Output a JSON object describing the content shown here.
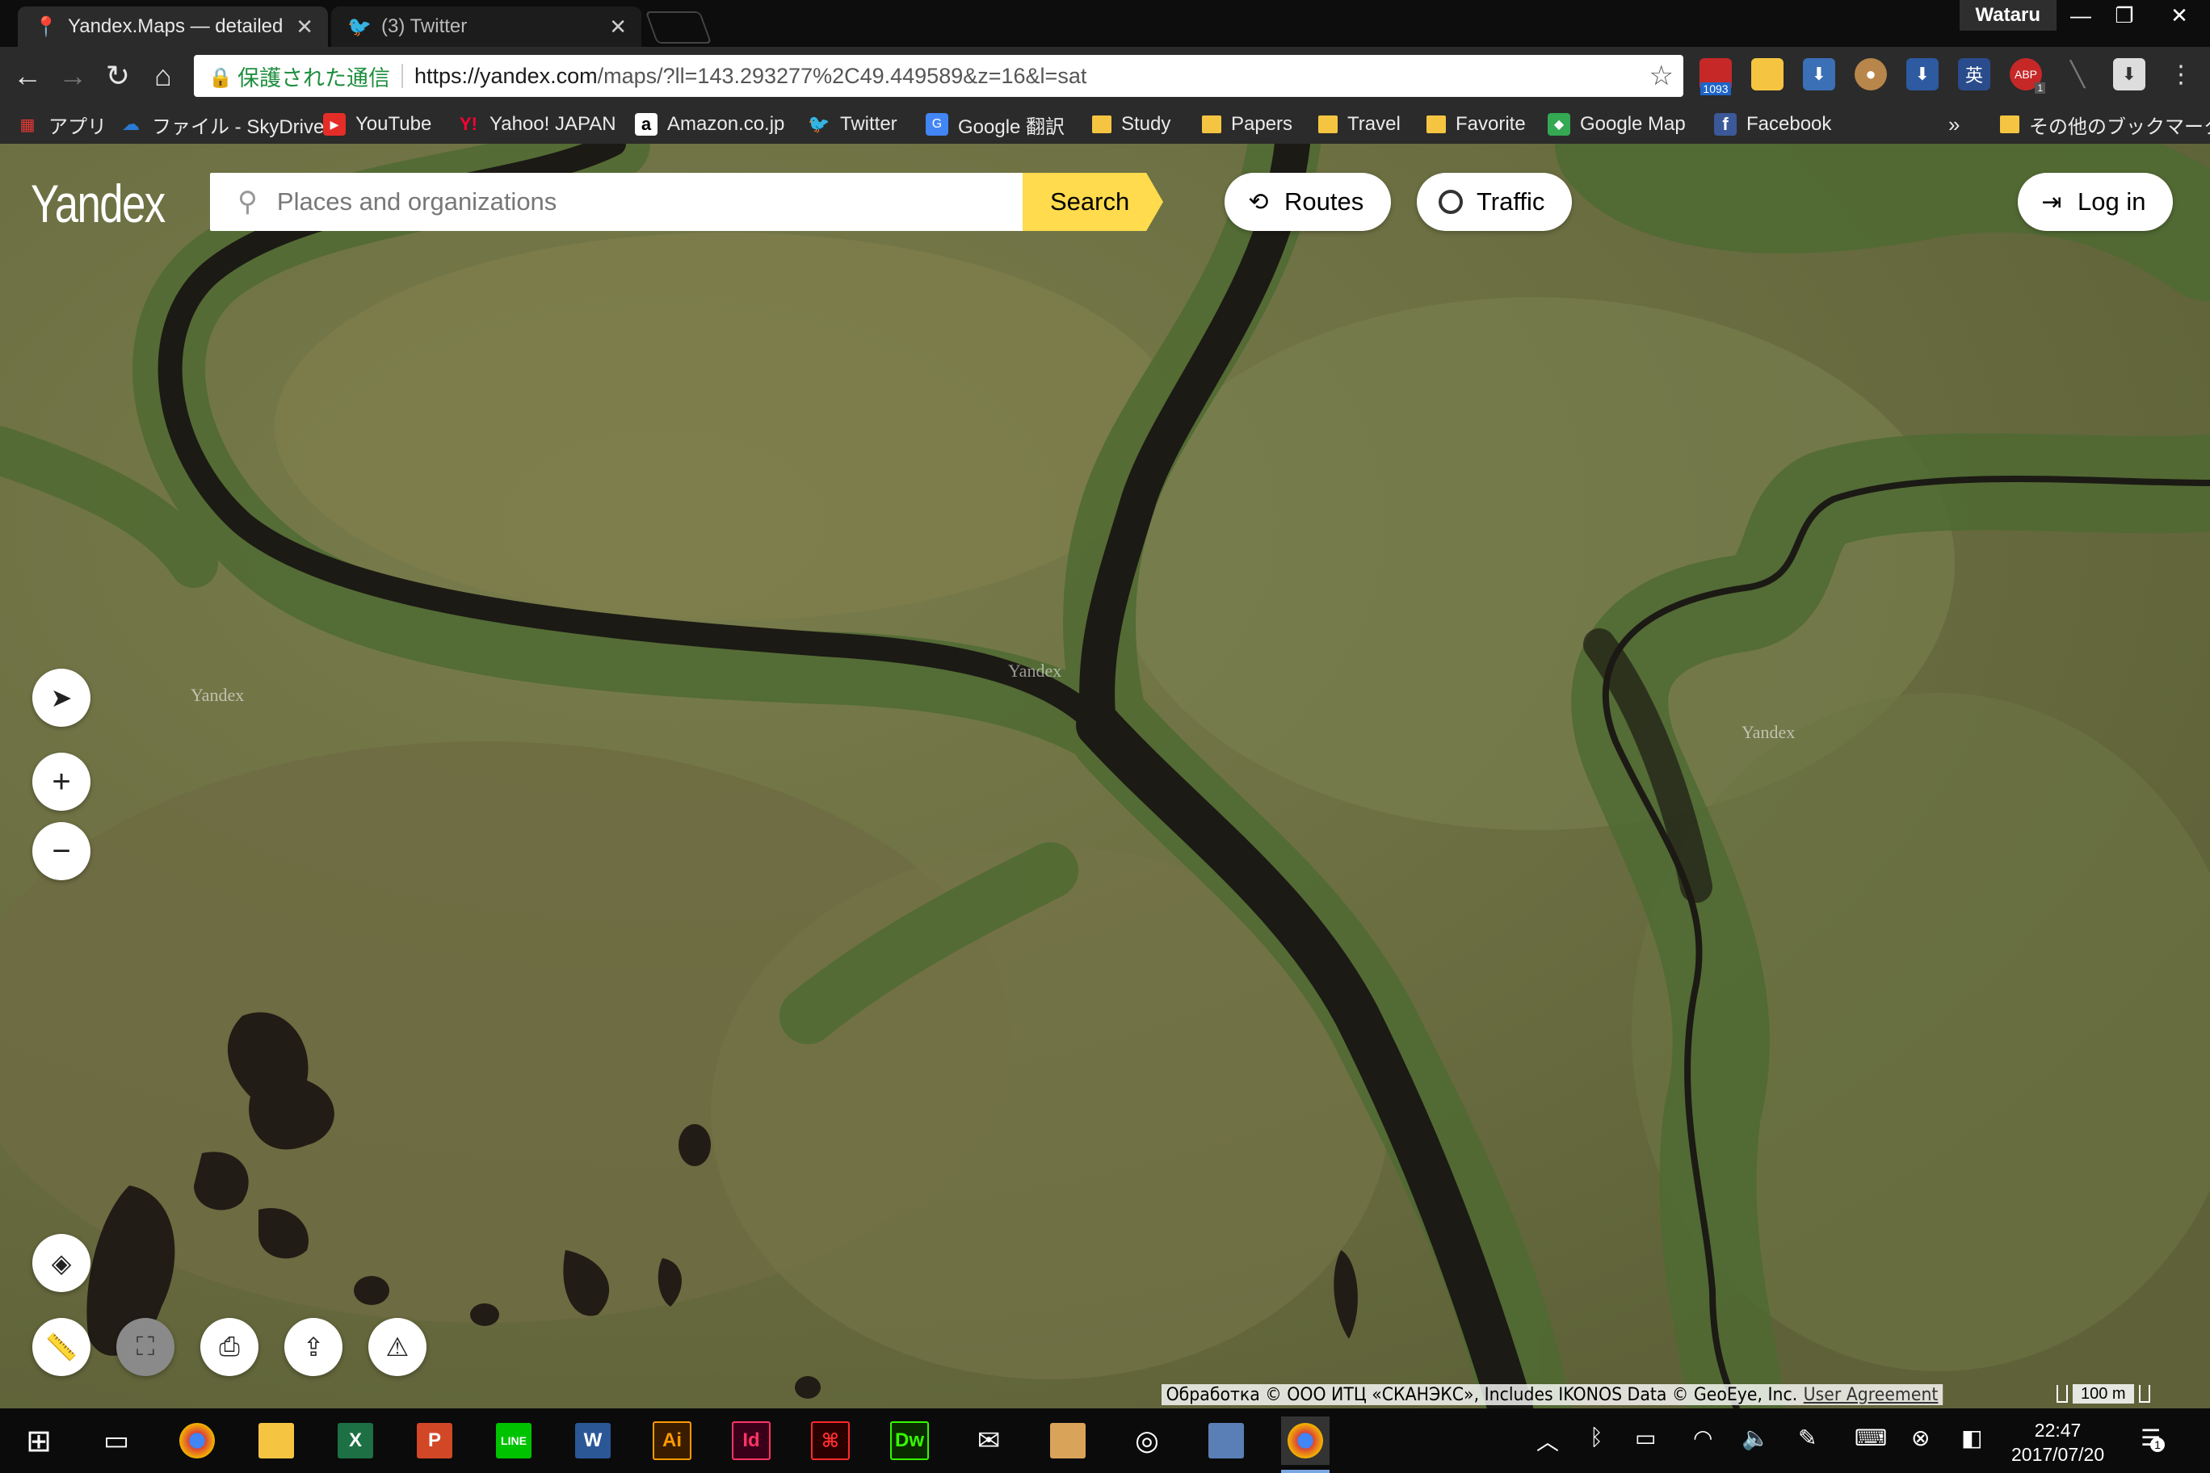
{
  "browser": {
    "tabs": [
      {
        "title": "Yandex.Maps — detailed",
        "icon": "map-pin-icon",
        "active": true
      },
      {
        "title": "(3) Twitter",
        "icon": "twitter-icon",
        "active": false
      }
    ],
    "profile_name": "Wataru",
    "omnibox": {
      "secure_label": "保護された通信",
      "url_host": "https://yandex.com",
      "url_path": "/maps/?ll=143.293277%2C49.449589&z=16&l=sat"
    },
    "extensions": {
      "badge_count": "1093",
      "abp_count": "1",
      "ime_label": "英"
    },
    "bookmarks": [
      {
        "label": "アプリ",
        "icon": "apps-grid-icon"
      },
      {
        "label": "ファイル - SkyDrive",
        "icon": "skydrive-icon"
      },
      {
        "label": "YouTube",
        "icon": "youtube-icon"
      },
      {
        "label": "Yahoo! JAPAN",
        "icon": "yahoo-icon"
      },
      {
        "label": "Amazon.co.jp",
        "icon": "amazon-icon"
      },
      {
        "label": "Twitter",
        "icon": "twitter-icon"
      },
      {
        "label": "Google 翻訳",
        "icon": "google-translate-icon"
      },
      {
        "label": "Study",
        "icon": "folder-icon"
      },
      {
        "label": "Papers",
        "icon": "folder-icon"
      },
      {
        "label": "Travel",
        "icon": "folder-icon"
      },
      {
        "label": "Favorite",
        "icon": "folder-icon"
      },
      {
        "label": "Google Map",
        "icon": "google-maps-icon"
      },
      {
        "label": "Facebook",
        "icon": "facebook-icon"
      }
    ],
    "overflow_label": "»",
    "other_bookmarks": "その他のブックマーク"
  },
  "map": {
    "logo": "Yandex",
    "search_placeholder": "Places and organizations",
    "search_button": "Search",
    "routes_label": "Routes",
    "traffic_label": "Traffic",
    "login_label": "Log in",
    "watermark": "Yandex",
    "copyright": "Обработка © ООО ИТЦ «СКАНЭКС», Includes IKONOS Data © GeoEye, Inc.",
    "user_agreement": "User Agreement",
    "scale_label": "100 m",
    "accent_color": "#ffdb4d"
  },
  "taskbar": {
    "time": "22:47",
    "date": "2017/07/20",
    "notification_count": "1",
    "apps": [
      "Chrome",
      "File Explorer",
      "Excel",
      "PowerPoint",
      "LINE",
      "Word",
      "Illustrator",
      "InDesign",
      "Acrobat",
      "Dreamweaver",
      "Mail",
      "Photos",
      "Groove",
      "Network",
      "Chrome"
    ]
  }
}
